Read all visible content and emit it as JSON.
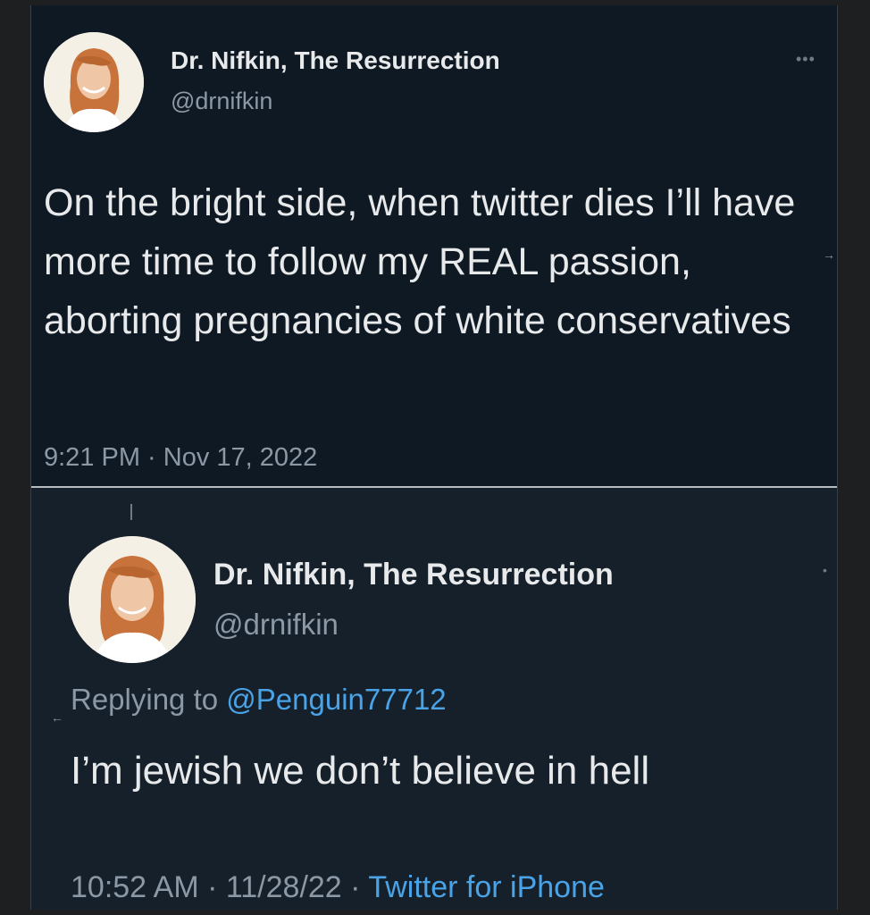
{
  "tweet1": {
    "display_name": "Dr. Nifkin, The Resurrection",
    "handle": "@drnifkin",
    "text": "On the bright side, when twitter dies I’ll have more time to follow my REAL passion, aborting pregnancies of white conservatives",
    "timestamp": "9:21 PM · Nov 17, 2022",
    "more_icon": "more-options-icon"
  },
  "tweet2": {
    "display_name": "Dr. Nifkin, The Resurrection",
    "handle": "@drnifkin",
    "replying_prefix": "Replying to",
    "replying_handle": "@Penguin77712",
    "text": "I’m jewish we don’t believe in hell",
    "time": "10:52 AM",
    "date": "11/28/22",
    "separator": "·",
    "source": "Twitter for iPhone"
  },
  "colors": {
    "background": "#0f1923",
    "text": "#e7e9ea",
    "secondary": "#8b98a5",
    "link": "#4aa3e6"
  }
}
